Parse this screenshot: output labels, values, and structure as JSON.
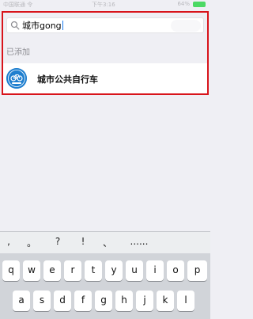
{
  "status_bar": {
    "carrier": "中国联通 令",
    "time": "下午3:16",
    "battery_pct": "64%"
  },
  "search": {
    "query": "城市gong"
  },
  "section": {
    "title": "已添加"
  },
  "results": [
    {
      "label": "城市公共自行车",
      "icon": "bicycle-logo-icon"
    }
  ],
  "keyboard": {
    "punctuation": [
      ",",
      "。",
      "?",
      "!",
      "、",
      "......"
    ],
    "row1": [
      "q",
      "w",
      "e",
      "r",
      "t",
      "y",
      "u",
      "i",
      "o",
      "p"
    ],
    "row2": [
      "a",
      "s",
      "d",
      "f",
      "g",
      "h",
      "j",
      "k",
      "l"
    ]
  },
  "colors": {
    "highlight": "#d8141b",
    "icon_blue": "#1f7fcf",
    "caret": "#1a7cf0"
  }
}
